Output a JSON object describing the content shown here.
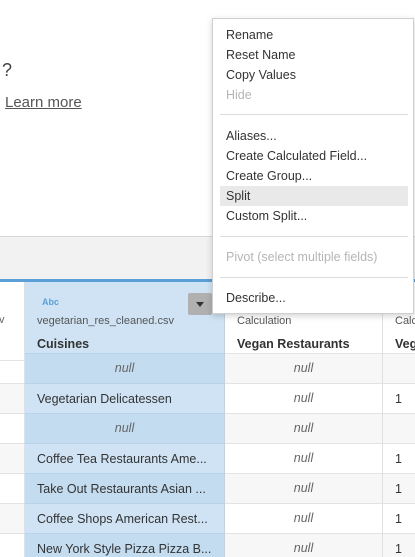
{
  "background": {
    "question_mark": "?",
    "learn_more": "Learn more"
  },
  "columns": {
    "a": {
      "source_fragment": "csv"
    },
    "b": {
      "type_badge": "Abc",
      "source": "vegetarian_res_cleaned.csv",
      "field": "Cuisines",
      "values": [
        "null",
        "Vegetarian  Delicatessen",
        "null",
        "Coffee  Tea Restaurants Ame...",
        "Take Out Restaurants Asian ...",
        "Coffee Shops American Rest...",
        "New York Style Pizza Pizza B..."
      ]
    },
    "c": {
      "source": "Calculation",
      "field": "Vegan Restaurants",
      "values": [
        "null",
        "null",
        "null",
        "null",
        "null",
        "null",
        "null"
      ]
    },
    "d": {
      "source": "Calc",
      "field": "Veg",
      "values": [
        "",
        "1",
        "",
        "1",
        "1",
        "1",
        "1"
      ]
    }
  },
  "menu": {
    "items": [
      {
        "label": "Rename",
        "enabled": true
      },
      {
        "label": "Reset Name",
        "enabled": true
      },
      {
        "label": "Copy Values",
        "enabled": true
      },
      {
        "label": "Hide",
        "enabled": false
      },
      {
        "label": "Aliases...",
        "enabled": true
      },
      {
        "label": "Create Calculated Field...",
        "enabled": true
      },
      {
        "label": "Create Group...",
        "enabled": true
      },
      {
        "label": "Split",
        "enabled": true,
        "highlighted": true
      },
      {
        "label": "Custom Split...",
        "enabled": true
      },
      {
        "label": "Pivot (select multiple fields)",
        "enabled": false
      },
      {
        "label": "Describe...",
        "enabled": true
      }
    ]
  },
  "colors": {
    "selected_column": "#cfe3f4",
    "accent_strip": "#5a9fd6",
    "menu_highlight": "#e9e9e9"
  }
}
